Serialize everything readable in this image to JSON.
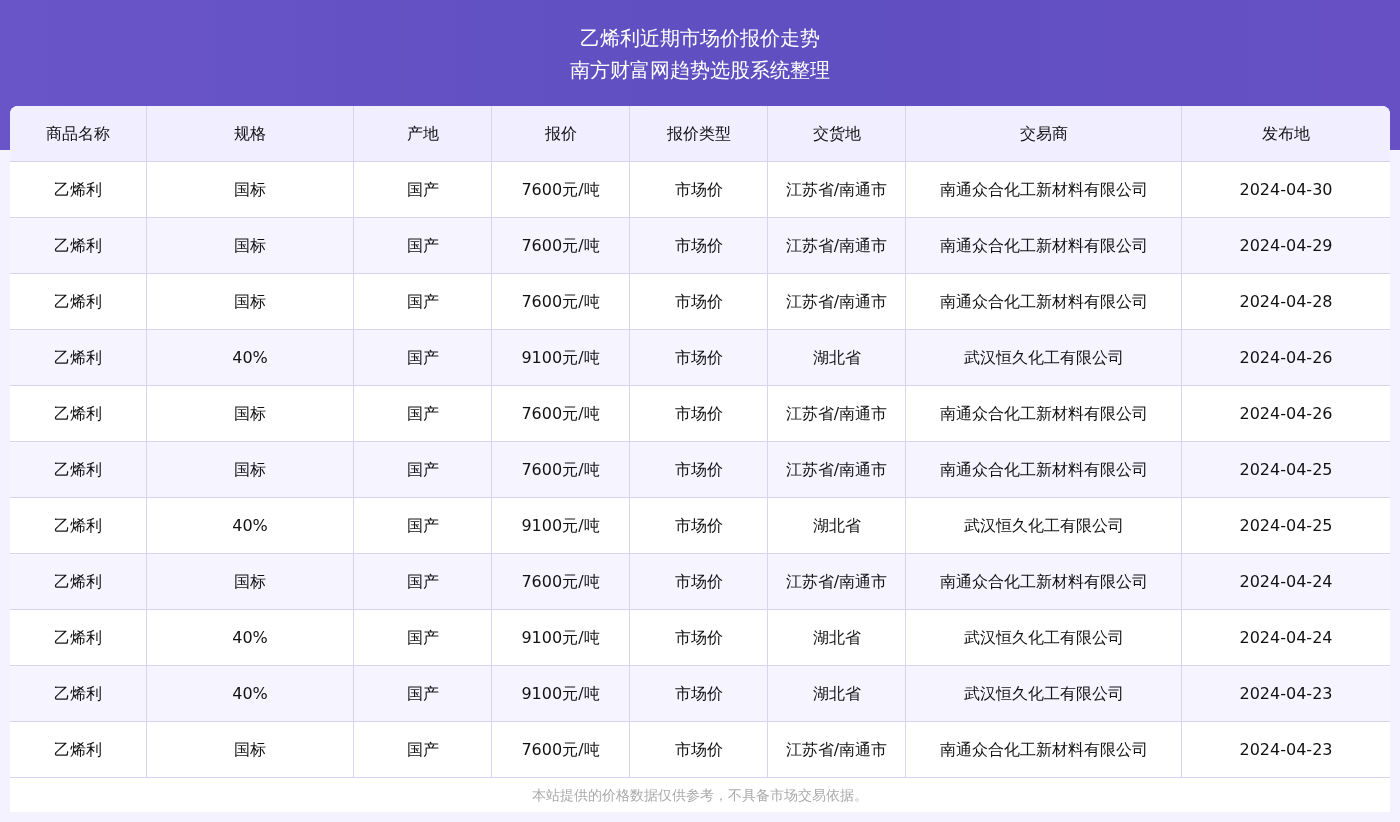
{
  "header": {
    "title": "乙烯利近期市场价报价走势",
    "subtitle": "南方财富网趋势选股系统整理"
  },
  "table": {
    "columns": [
      "商品名称",
      "规格",
      "产地",
      "报价",
      "报价类型",
      "交货地",
      "交易商",
      "发布地"
    ],
    "rows": [
      [
        "乙烯利",
        "国标",
        "国产",
        "7600元/吨",
        "市场价",
        "江苏省/南通市",
        "南通众合化工新材料有限公司",
        "2024-04-30"
      ],
      [
        "乙烯利",
        "国标",
        "国产",
        "7600元/吨",
        "市场价",
        "江苏省/南通市",
        "南通众合化工新材料有限公司",
        "2024-04-29"
      ],
      [
        "乙烯利",
        "国标",
        "国产",
        "7600元/吨",
        "市场价",
        "江苏省/南通市",
        "南通众合化工新材料有限公司",
        "2024-04-28"
      ],
      [
        "乙烯利",
        "40%",
        "国产",
        "9100元/吨",
        "市场价",
        "湖北省",
        "武汉恒久化工有限公司",
        "2024-04-26"
      ],
      [
        "乙烯利",
        "国标",
        "国产",
        "7600元/吨",
        "市场价",
        "江苏省/南通市",
        "南通众合化工新材料有限公司",
        "2024-04-26"
      ],
      [
        "乙烯利",
        "国标",
        "国产",
        "7600元/吨",
        "市场价",
        "江苏省/南通市",
        "南通众合化工新材料有限公司",
        "2024-04-25"
      ],
      [
        "乙烯利",
        "40%",
        "国产",
        "9100元/吨",
        "市场价",
        "湖北省",
        "武汉恒久化工有限公司",
        "2024-04-25"
      ],
      [
        "乙烯利",
        "国标",
        "国产",
        "7600元/吨",
        "市场价",
        "江苏省/南通市",
        "南通众合化工新材料有限公司",
        "2024-04-24"
      ],
      [
        "乙烯利",
        "40%",
        "国产",
        "9100元/吨",
        "市场价",
        "湖北省",
        "武汉恒久化工有限公司",
        "2024-04-24"
      ],
      [
        "乙烯利",
        "40%",
        "国产",
        "9100元/吨",
        "市场价",
        "湖北省",
        "武汉恒久化工有限公司",
        "2024-04-23"
      ],
      [
        "乙烯利",
        "国标",
        "国产",
        "7600元/吨",
        "市场价",
        "江苏省/南通市",
        "南通众合化工新材料有限公司",
        "2024-04-23"
      ]
    ]
  },
  "footnote": "本站提供的价格数据仅供参考，不具备市场交易依据。"
}
